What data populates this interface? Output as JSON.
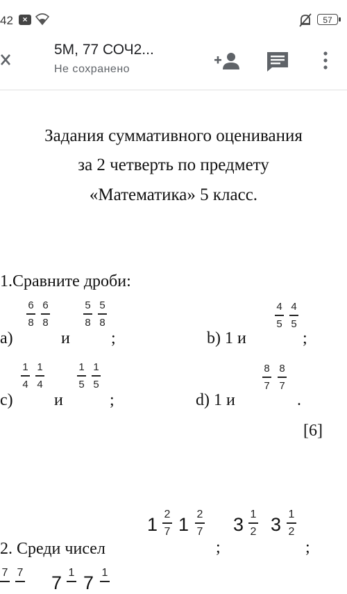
{
  "status_bar": {
    "time": "42",
    "battery": "57"
  },
  "app_bar": {
    "title": "5М, 77 СОЧ2...",
    "subtitle": "Не сохранено"
  },
  "document": {
    "heading_lines": [
      "Задания суммативного оценивания",
      "за 2 четверть по предмету",
      "«Математика» 5 класс."
    ],
    "task1": {
      "title": "1.Сравните дроби:",
      "a_label": "a)",
      "a_and": "и",
      "a_end": ";",
      "a_frac1": [
        "6",
        "8"
      ],
      "a_frac2": [
        "6",
        "8"
      ],
      "a_frac3": [
        "5",
        "8"
      ],
      "a_frac4": [
        "5",
        "8"
      ],
      "b_label": "b) 1 и",
      "b_end": ";",
      "b_frac1": [
        "4",
        "5"
      ],
      "b_frac2": [
        "4",
        "5"
      ],
      "c_label": "c)",
      "c_and": "и",
      "c_end": ";",
      "c_frac1": [
        "1",
        "4"
      ],
      "c_frac2": [
        "1",
        "4"
      ],
      "c_frac3": [
        "1",
        "5"
      ],
      "c_frac4": [
        "1",
        "5"
      ],
      "d_label": "d) 1 и",
      "d_end": ".",
      "d_frac1": [
        "8",
        "7"
      ],
      "d_frac2": [
        "8",
        "7"
      ],
      "score": "[6]"
    },
    "task2": {
      "title": "2. Среди чисел",
      "n1_whole": "1",
      "n1_frac": [
        "2",
        "7"
      ],
      "n2_whole": "1",
      "n2_frac": [
        "2",
        "7"
      ],
      "sep1": ";",
      "n3_whole": "3",
      "n3_frac": [
        "1",
        "2"
      ],
      "n4_whole": "3",
      "n4_frac": [
        "1",
        "2"
      ],
      "sep2": ";",
      "n5_frac": [
        "7",
        ""
      ],
      "n6_frac": [
        "7",
        ""
      ],
      "n7_whole": "7",
      "n7_frac": [
        "1",
        ""
      ],
      "n8_whole": "7",
      "n8_frac": [
        "1",
        ""
      ]
    }
  }
}
